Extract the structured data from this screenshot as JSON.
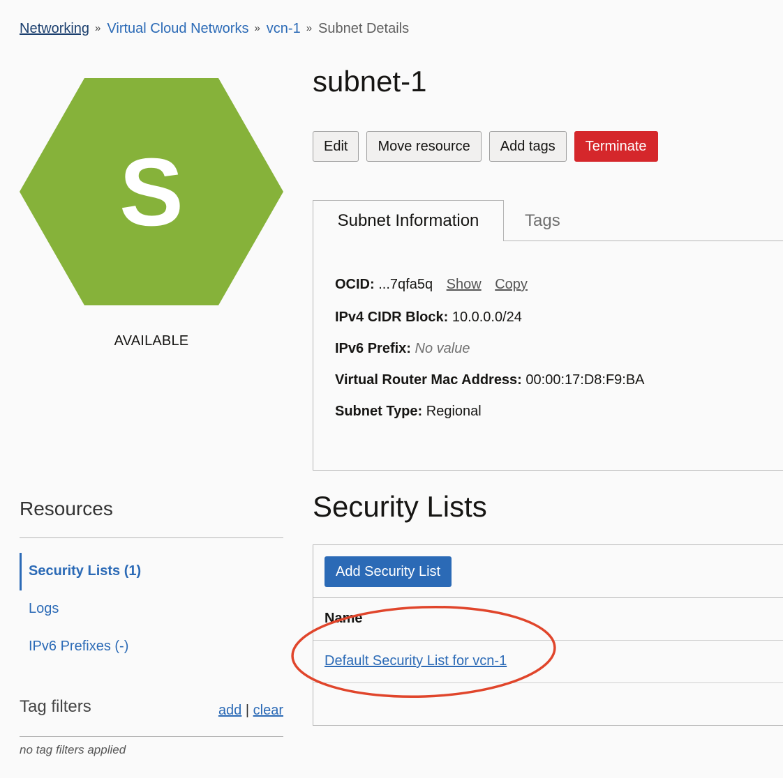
{
  "breadcrumb": {
    "items": [
      "Networking",
      "Virtual Cloud Networks",
      "vcn-1"
    ],
    "current": "Subnet Details",
    "separator": "»"
  },
  "resource": {
    "icon_letter": "S",
    "icon_color": "#86b23a",
    "status": "AVAILABLE",
    "title": "subnet-1"
  },
  "actions": {
    "edit": "Edit",
    "move": "Move resource",
    "add_tags": "Add tags",
    "terminate": "Terminate"
  },
  "tabs": {
    "info": "Subnet Information",
    "tags": "Tags"
  },
  "info": {
    "ocid_label": "OCID:",
    "ocid_value": "...7qfa5q",
    "show": "Show",
    "copy": "Copy",
    "cidr_label": "IPv4 CIDR Block:",
    "cidr_value": "10.0.0.0/24",
    "ipv6_label": "IPv6 Prefix:",
    "ipv6_value": "No value",
    "mac_label": "Virtual Router Mac Address:",
    "mac_value": "00:00:17:D8:F9:BA",
    "type_label": "Subnet Type:",
    "type_value": "Regional"
  },
  "resources": {
    "title": "Resources",
    "items": [
      "Security Lists (1)",
      "Logs",
      "IPv6 Prefixes (-)"
    ]
  },
  "tag_filters": {
    "title": "Tag filters",
    "add": "add",
    "divider": "|",
    "clear": "clear",
    "empty": "no tag filters applied"
  },
  "security_lists": {
    "title": "Security Lists",
    "add_button": "Add Security List",
    "column_name": "Name",
    "rows": [
      "Default Security List for vcn-1"
    ]
  },
  "colors": {
    "primary": "#2b6ab6",
    "danger": "#d5272b",
    "annotation": "#e0452b"
  }
}
